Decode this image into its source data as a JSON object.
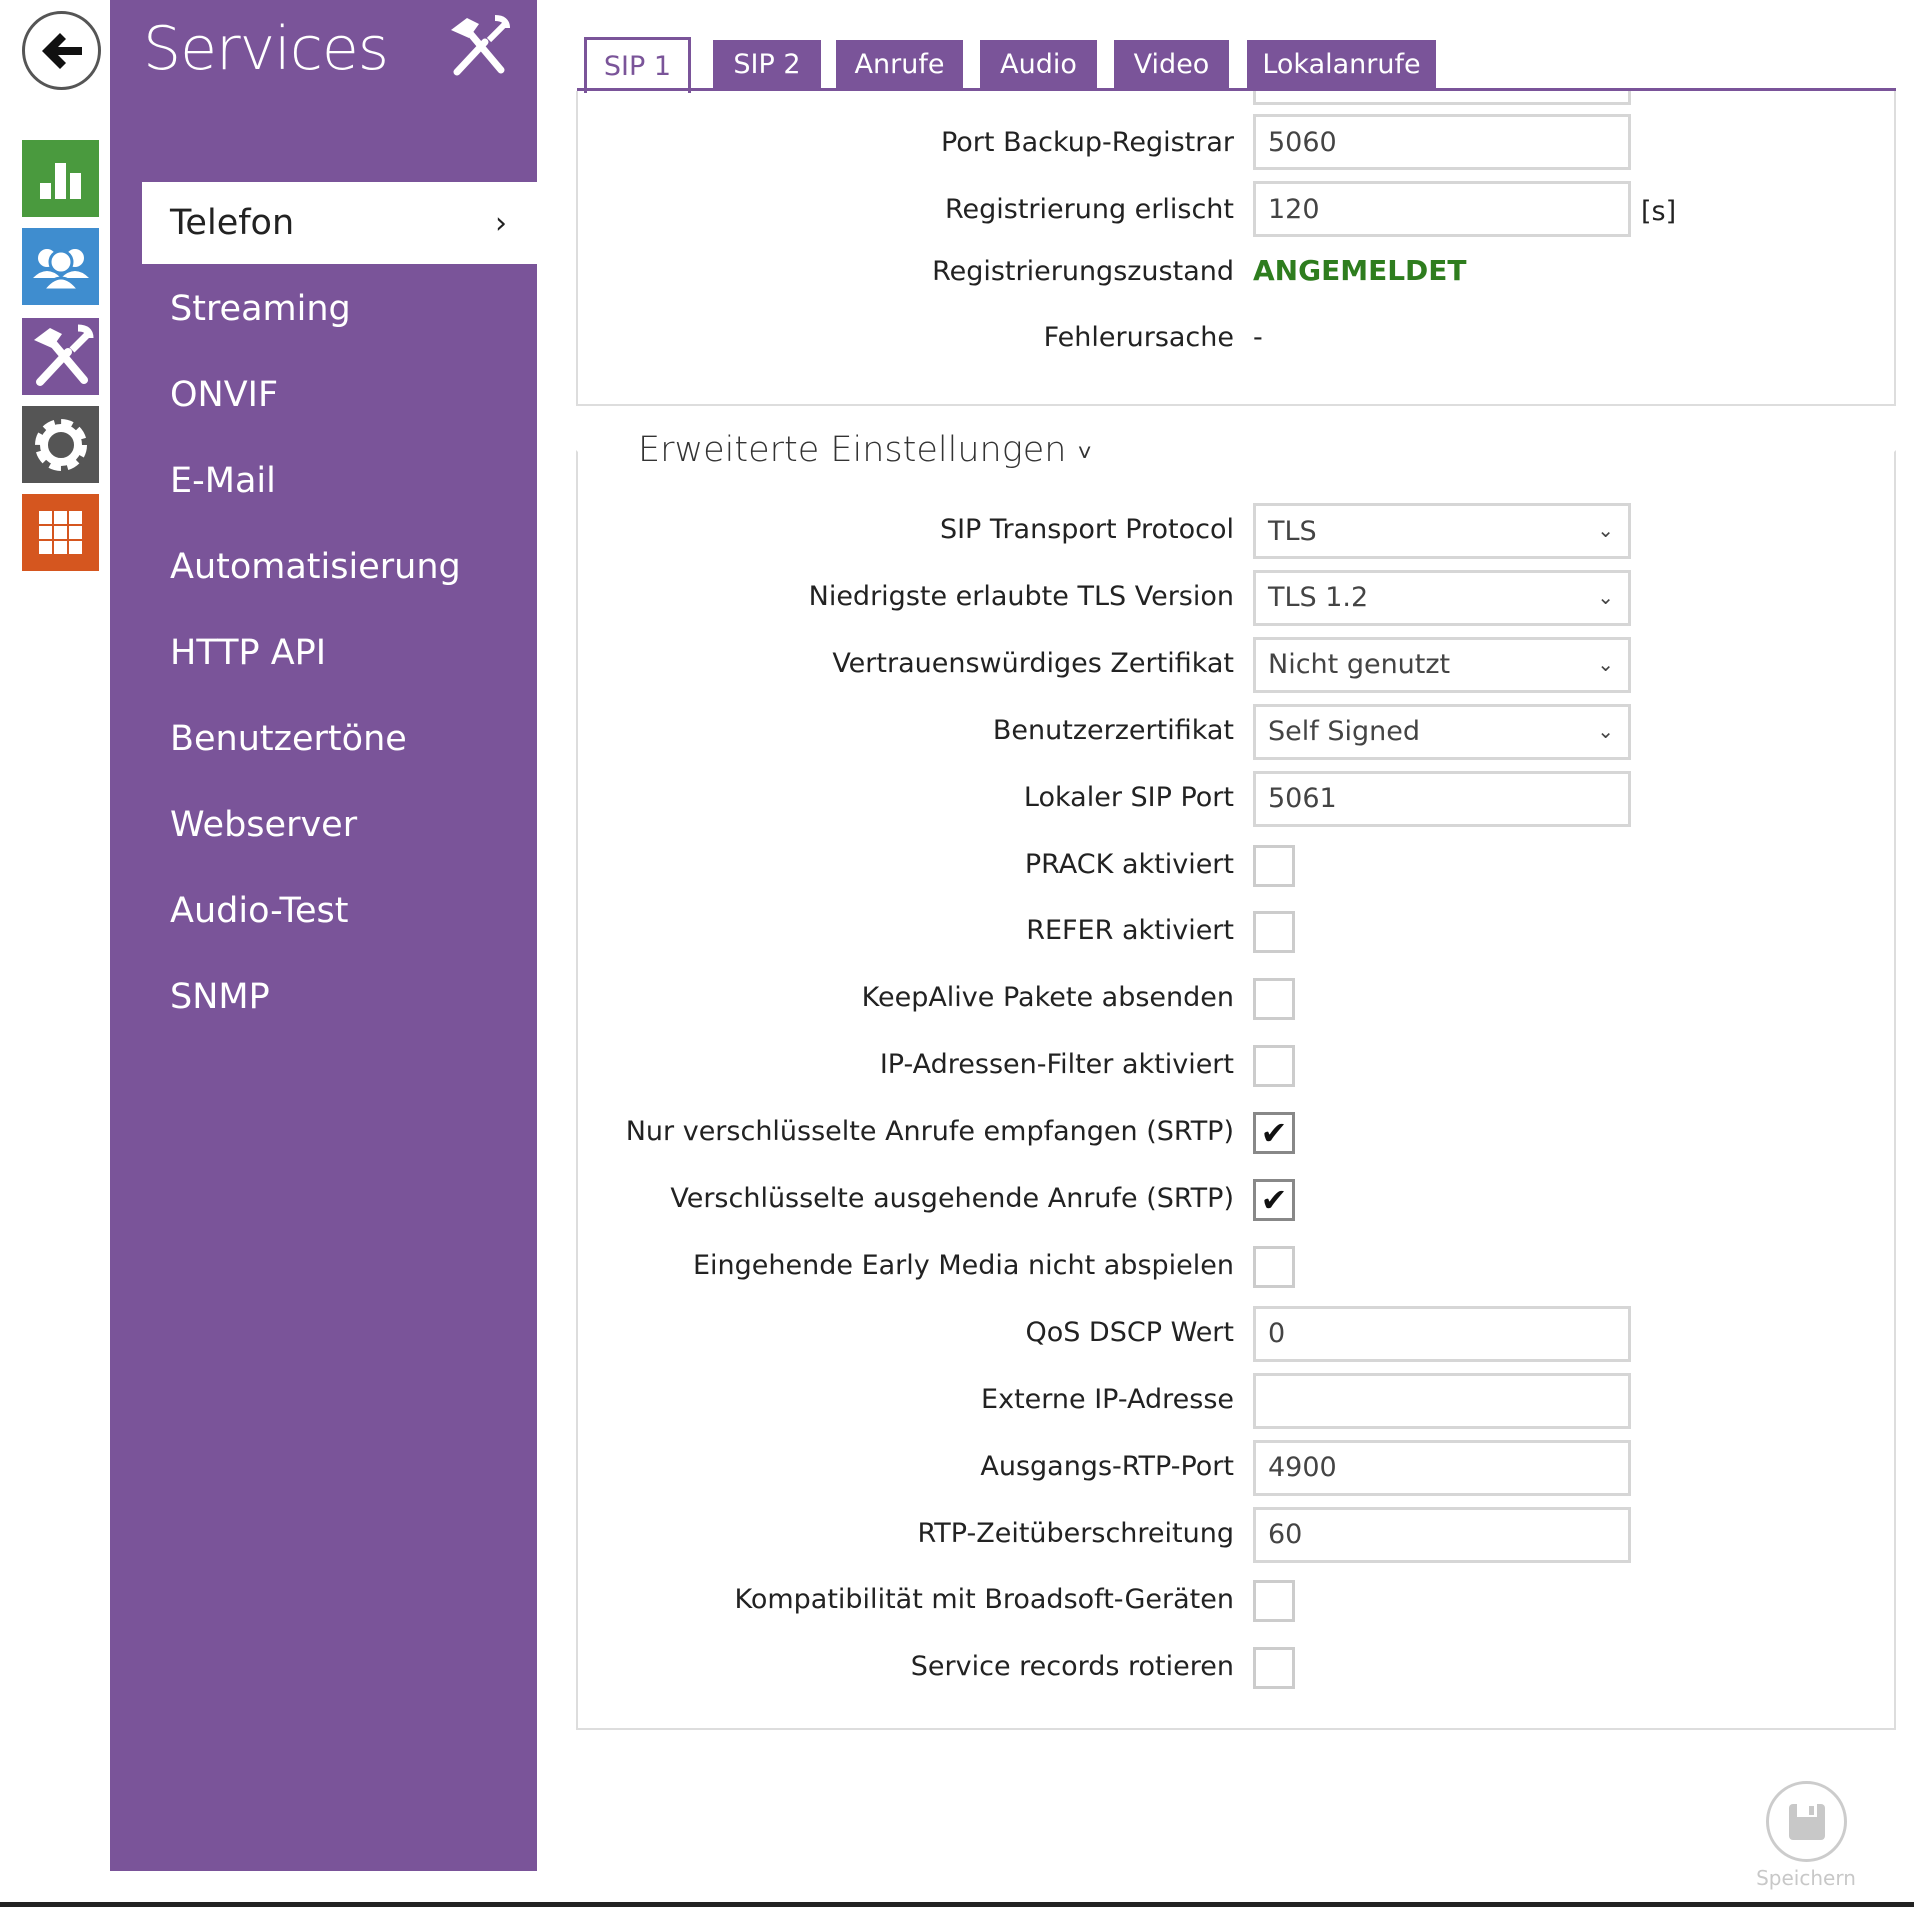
{
  "nav": {
    "apps": [
      {
        "icon": "status-chart-icon",
        "color": "#4a9a3e"
      },
      {
        "icon": "users-icon",
        "color": "#3f8dcf"
      },
      {
        "icon": "services-tools-icon",
        "color": "#7a5499"
      },
      {
        "icon": "settings-gear-icon",
        "color": "#555555"
      },
      {
        "icon": "apps-grid-icon",
        "color": "#d5561f"
      }
    ]
  },
  "sidebar": {
    "title": "Services",
    "items": [
      {
        "label": "Telefon",
        "active": true
      },
      {
        "label": "Streaming"
      },
      {
        "label": "ONVIF"
      },
      {
        "label": "E-Mail"
      },
      {
        "label": "Automatisierung"
      },
      {
        "label": "HTTP API"
      },
      {
        "label": "Benutzertöne"
      },
      {
        "label": "Webserver"
      },
      {
        "label": "Audio-Test"
      },
      {
        "label": "SNMP"
      }
    ],
    "chevron": "›"
  },
  "tabs": [
    {
      "label": "SIP 1",
      "active": true
    },
    {
      "label": "SIP 2"
    },
    {
      "label": "Anrufe"
    },
    {
      "label": "Audio"
    },
    {
      "label": "Video"
    },
    {
      "label": "Lokalanrufe"
    }
  ],
  "basic": {
    "port_backup": {
      "label": "Port Backup-Registrar",
      "value": "5060"
    },
    "expiry": {
      "label": "Registrierung erlischt",
      "value": "120",
      "unit": "[s]"
    },
    "state": {
      "label": "Registrierungszustand",
      "value": "ANGEMELDET",
      "color": "#2e7d1e"
    },
    "error": {
      "label": "Fehlerursache",
      "value": "-"
    }
  },
  "advanced": {
    "title": "Erweiterte Einstellungen",
    "chevron": "˅",
    "rows": [
      {
        "label": "SIP Transport Protocol",
        "type": "select",
        "value": "TLS"
      },
      {
        "label": "Niedrigste erlaubte TLS Version",
        "type": "select",
        "value": "TLS 1.2"
      },
      {
        "label": "Vertrauenswürdiges Zertifikat",
        "type": "select",
        "value": "Nicht genutzt"
      },
      {
        "label": "Benutzerzertifikat",
        "type": "select",
        "value": "Self Signed"
      },
      {
        "label": "Lokaler SIP Port",
        "type": "input",
        "value": "5061"
      },
      {
        "label": "PRACK aktiviert",
        "type": "checkbox",
        "checked": false
      },
      {
        "label": "REFER aktiviert",
        "type": "checkbox",
        "checked": false
      },
      {
        "label": "KeepAlive Pakete absenden",
        "type": "checkbox",
        "checked": false
      },
      {
        "label": "IP-Adressen-Filter aktiviert",
        "type": "checkbox",
        "checked": false
      },
      {
        "label": "Nur verschlüsselte Anrufe empfangen (SRTP)",
        "type": "checkbox",
        "checked": true
      },
      {
        "label": "Verschlüsselte ausgehende Anrufe (SRTP)",
        "type": "checkbox",
        "checked": true
      },
      {
        "label": "Eingehende Early Media nicht abspielen",
        "type": "checkbox",
        "checked": false
      },
      {
        "label": "QoS DSCP Wert",
        "type": "input",
        "value": "0"
      },
      {
        "label": "Externe IP-Adresse",
        "type": "input",
        "value": ""
      },
      {
        "label": "Ausgangs-RTP-Port",
        "type": "input",
        "value": "4900"
      },
      {
        "label": "RTP-Zeitüberschreitung",
        "type": "input",
        "value": "60"
      },
      {
        "label": "Kompatibilität mit Broadsoft-Geräten",
        "type": "checkbox",
        "checked": false
      },
      {
        "label": "Service records rotieren",
        "type": "checkbox",
        "checked": false
      }
    ]
  },
  "save": {
    "label": "Speichern",
    "icon": "floppy-disk-icon"
  }
}
